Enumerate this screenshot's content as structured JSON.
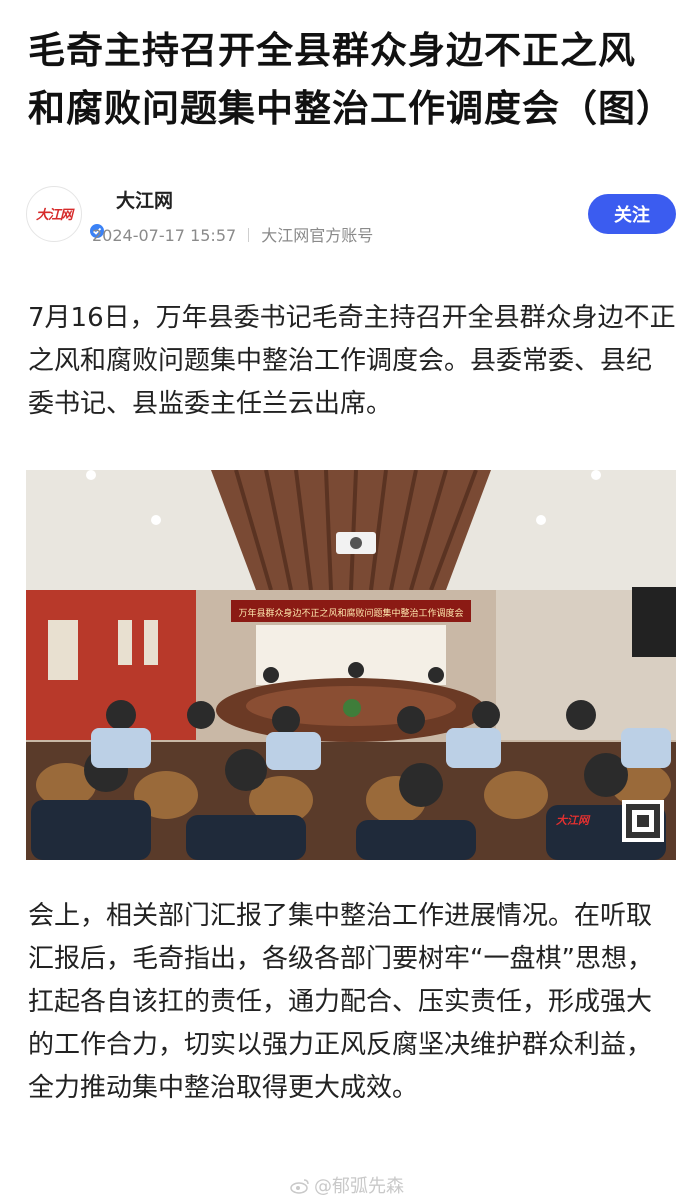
{
  "article": {
    "title": "毛奇主持召开全县群众身边不正之风和腐败问题集中整治工作调度会（图）",
    "author": {
      "name": "大江网",
      "avatar_logo": "大江网",
      "datetime": "2024-07-17 15:57",
      "account": "大江网官方账号",
      "follow_label": "关注"
    },
    "paragraph1": "7月16日，万年县委书记毛奇主持召开全县群众身边不正之风和腐败问题集中整治工作调度会。县委常委、县纪委书记、县监委主任兰云出席。",
    "photo": {
      "banner_text": "万年县群众身边不正之风和腐败问题集中整治工作调度会",
      "watermark_logo": "大江网"
    },
    "paragraph2": "会上，相关部门汇报了集中整治工作进展情况。在听取汇报后，毛奇指出，各级各部门要树牢“一盘棋”思想，扛起各自该扛的责任，通力配合、压实责任，形成强大的工作合力，切实以强力正风反腐坚决维护群众利益，全力推动集中整治取得更大成效。"
  },
  "footer": {
    "watermark": "@郁弧先森"
  },
  "icons": [
    "verified-badge-icon",
    "weibo-icon"
  ],
  "colors": {
    "follow_button": "#3b5cf0",
    "verified_badge": "#3b82f6",
    "logo_red": "#d62b2b"
  }
}
